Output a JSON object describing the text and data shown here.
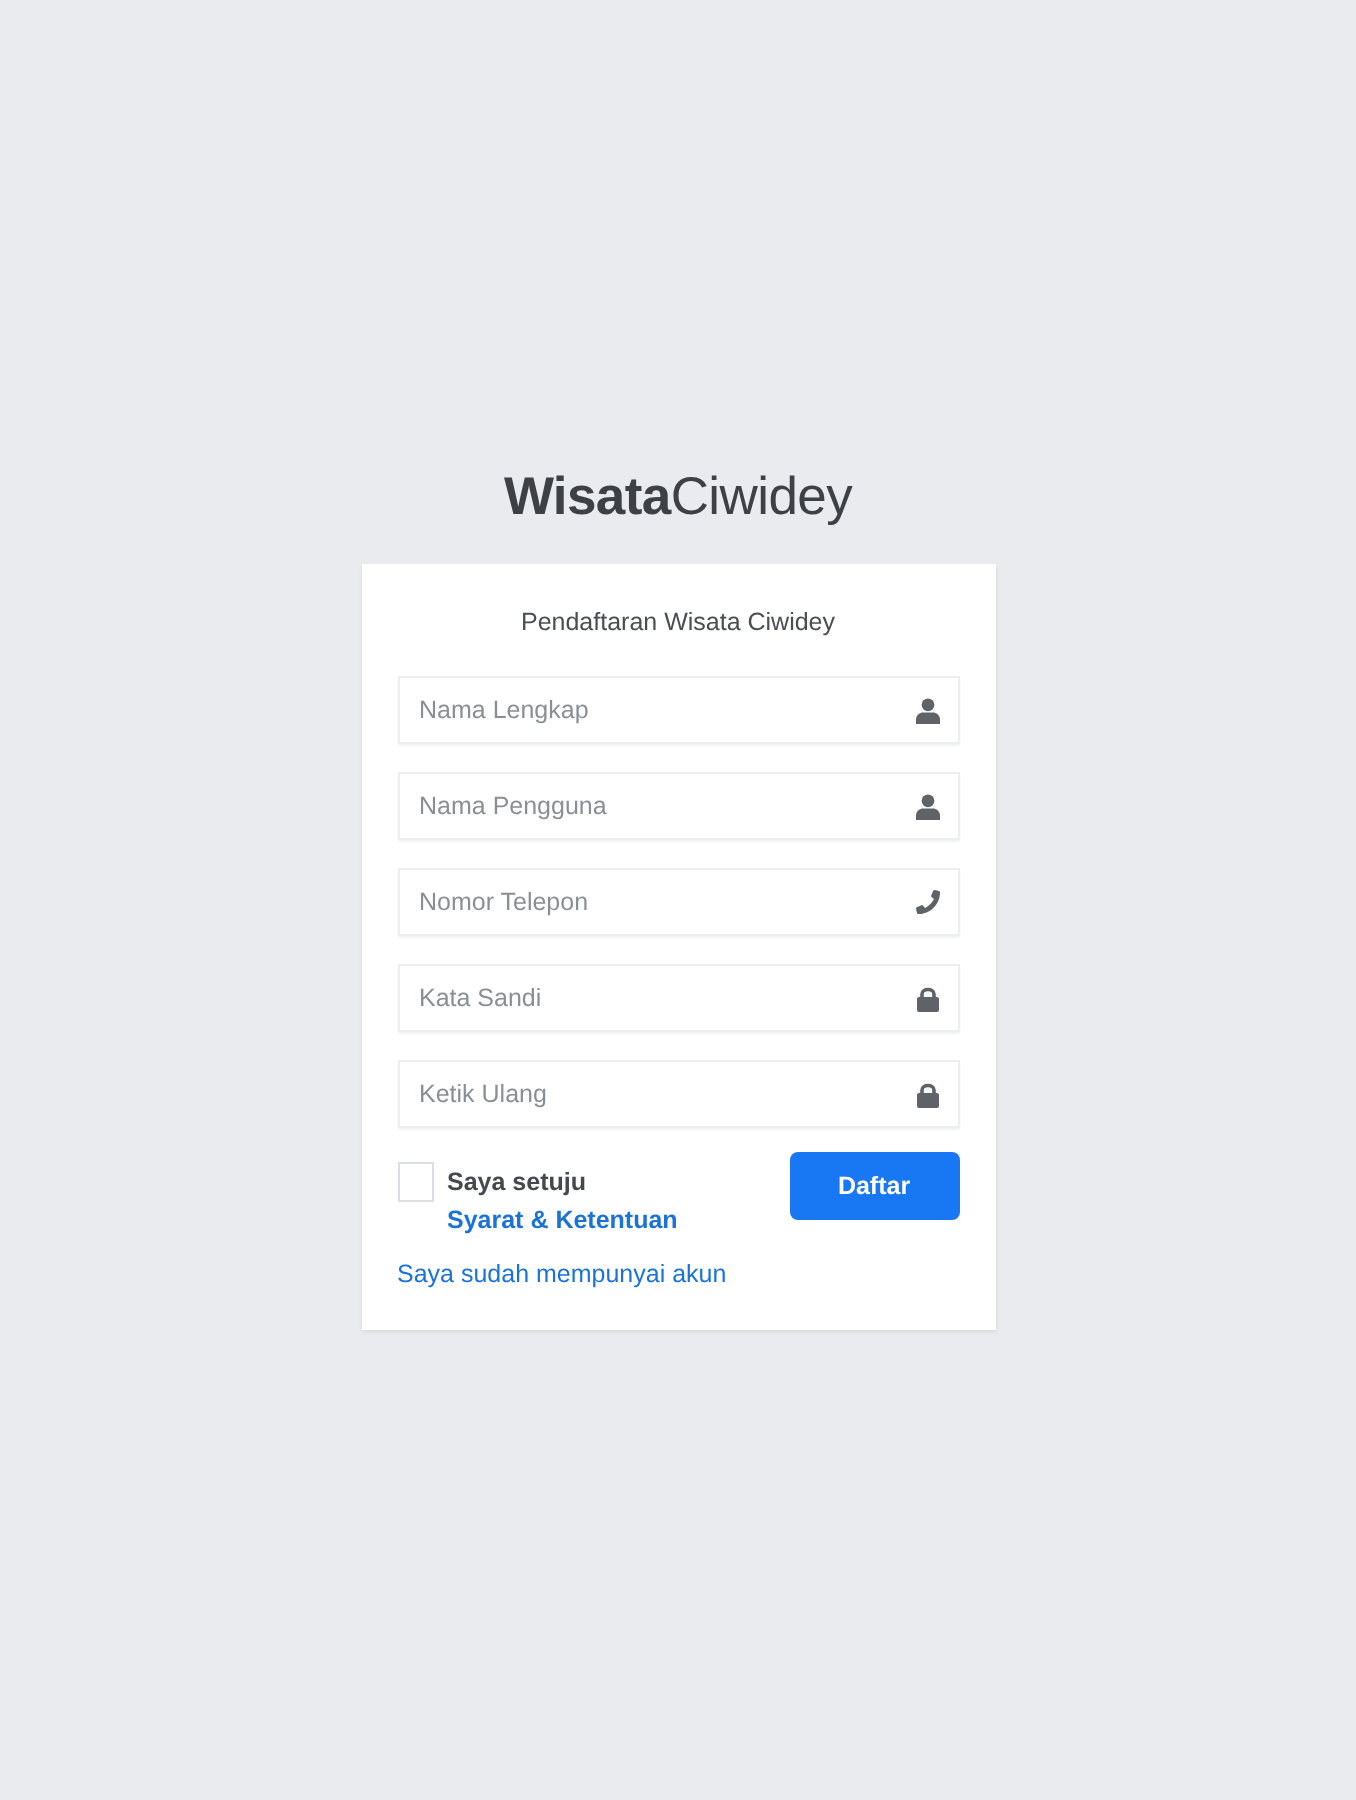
{
  "logo": {
    "text": "**Wisata**Ciwidey"
  },
  "card": {
    "title": "Pendaftaran Wisata Ciwidey",
    "fields": [
      {
        "kind": "person",
        "placeholder": "Nama Lengkap"
      },
      {
        "kind": "person",
        "placeholder": "Nama Pengguna"
      },
      {
        "kind": "phone",
        "placeholder": "Nomor Telepon"
      },
      {
        "kind": "password",
        "placeholder": "Kata Sandi"
      },
      {
        "kind": "password",
        "placeholder": "Ketik Ulang"
      }
    ],
    "terms": {
      "checked": false,
      "text": "Saya setuju",
      "link": "Syarat & Ketentuan"
    },
    "submit_button": "Daftar",
    "login_link": "Saya sudah mempunyai akun"
  }
}
